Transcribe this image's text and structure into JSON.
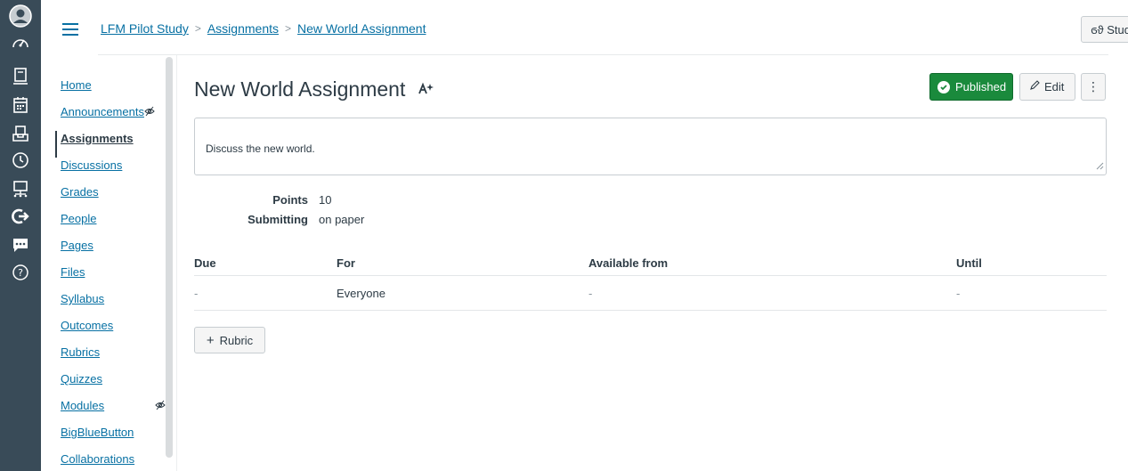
{
  "breadcrumb": {
    "course": "LFM Pilot Study",
    "section": "Assignments",
    "current": "New World Assignment"
  },
  "header": {
    "student_view_label": "Stud"
  },
  "course_nav": {
    "items": [
      {
        "label": "Home"
      },
      {
        "label": "Announcements"
      },
      {
        "label": "Assignments"
      },
      {
        "label": "Discussions"
      },
      {
        "label": "Grades"
      },
      {
        "label": "People"
      },
      {
        "label": "Pages"
      },
      {
        "label": "Files"
      },
      {
        "label": "Syllabus"
      },
      {
        "label": "Outcomes"
      },
      {
        "label": "Rubrics"
      },
      {
        "label": "Quizzes"
      },
      {
        "label": "Modules"
      },
      {
        "label": "BigBlueButton"
      },
      {
        "label": "Collaborations"
      }
    ],
    "active": "Assignments"
  },
  "assignment": {
    "title": "New World Assignment",
    "published_label": "Published",
    "edit_label": "Edit",
    "more_label": "⋮",
    "description": "Discuss the new world.",
    "details": [
      {
        "label": "Points",
        "value": "10"
      },
      {
        "label": "Submitting",
        "value": "on paper"
      }
    ],
    "dates_table": {
      "headers": [
        "Due",
        "For",
        "Available from",
        "Until"
      ],
      "rows": [
        [
          "-",
          "Everyone",
          "-",
          "-"
        ]
      ]
    },
    "rubric_label": "Rubric"
  },
  "colors": {
    "rail_bg": "#394b58",
    "link": "#0770a3",
    "published_green": "#1a8a3c",
    "text": "#2d3b45"
  },
  "icons": [
    "avatar-icon",
    "dashboard-icon",
    "courses-icon",
    "calendar-icon",
    "inbox-icon",
    "history-icon",
    "commons-icon",
    "studio-icon",
    "chat-icon",
    "help-icon",
    "hamburger-icon",
    "eye-off-icon",
    "ai-sparkle-icon",
    "check-circle-icon",
    "pencil-icon",
    "more-icon",
    "plus-icon",
    "resize-handle-icon"
  ]
}
